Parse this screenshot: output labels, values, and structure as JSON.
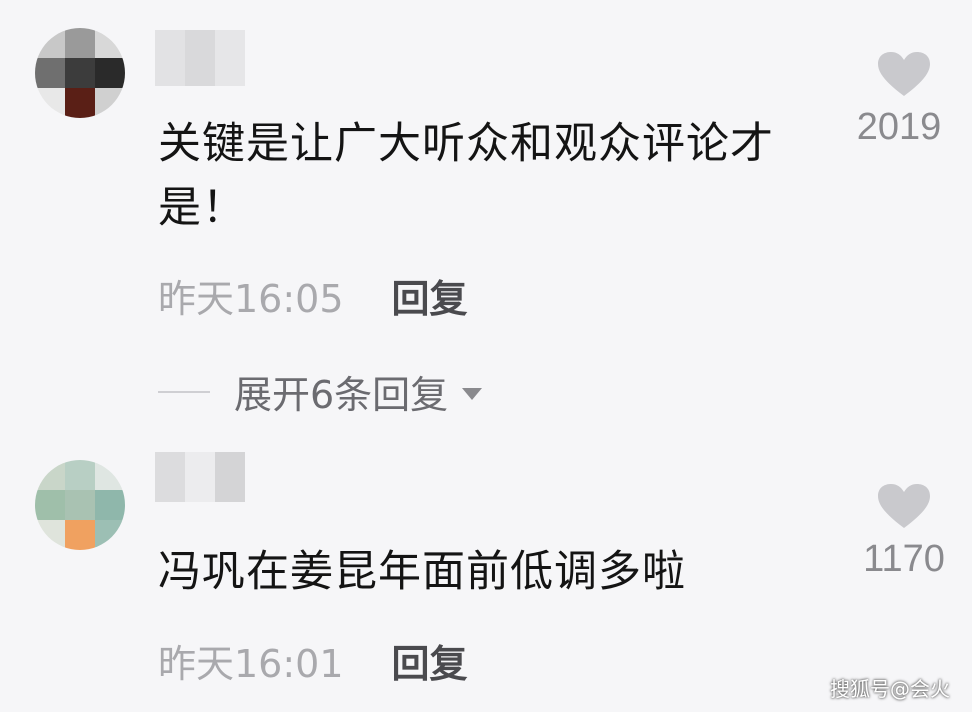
{
  "comments": [
    {
      "text": "关键是让广大听众和观众评论才是！",
      "like_count": "2019",
      "timestamp": "昨天16:05",
      "reply_label": "回复",
      "expand_label": "展开6条回复"
    },
    {
      "text": "冯巩在姜昆年面前低调多啦",
      "like_count": "1170",
      "timestamp": "昨天16:01",
      "reply_label": "回复"
    }
  ],
  "watermark": "搜狐号@会火",
  "icons": {
    "like": "heart-icon",
    "expand": "triangle-down-icon"
  },
  "colors": {
    "background": "#f6f6f8",
    "muted_text": "#a9a9ad",
    "like_count": "#8a8a8e",
    "heart": "#c9c9cd"
  }
}
